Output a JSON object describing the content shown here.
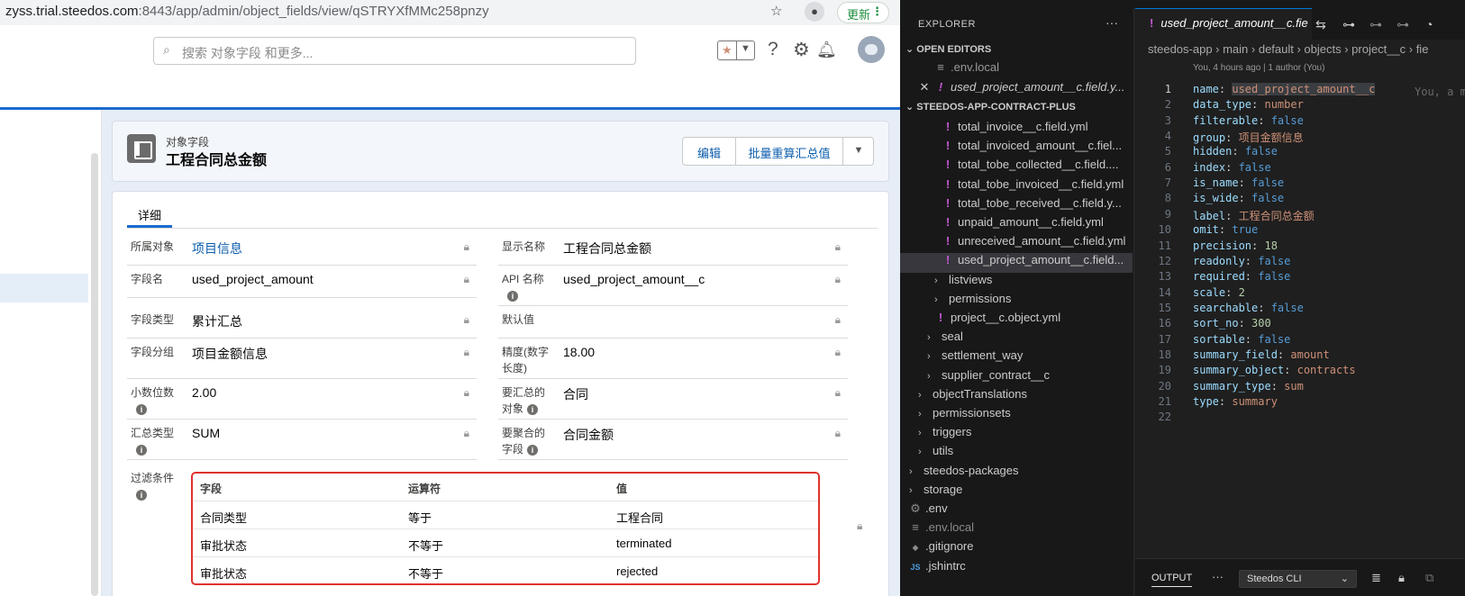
{
  "browser": {
    "url_host": "zyss.trial.steedos.com",
    "url_rest": ":8443/app/admin/object_fields/view/qSTRYXfMMc258pnzy",
    "update_label": "更新"
  },
  "app": {
    "search_placeholder": "搜索 对象字段 和更多..."
  },
  "record": {
    "object_label": "对象字段",
    "title": "工程合同总金额",
    "actions": [
      "编辑",
      "批量重算汇总值"
    ],
    "tab": "详细"
  },
  "fields_left": [
    {
      "label": "所属对象",
      "value": "项目信息",
      "link": true
    },
    {
      "label": "字段名",
      "value": "used_project_amount"
    },
    {
      "label": "字段类型",
      "value": "累计汇总"
    },
    {
      "label": "字段分组",
      "value": "项目金额信息"
    },
    {
      "label1": "小数位数",
      "value": "2.00"
    },
    {
      "label1": "汇总类型",
      "value": "SUM"
    }
  ],
  "fields_right": [
    {
      "label": "显示名称",
      "value": "工程合同总金额"
    },
    {
      "label1": "API 名称",
      "value": "used_project_amount__c"
    },
    {
      "label": "默认值",
      "value": ""
    },
    {
      "label1": "精度(数字",
      "label2": "长度)",
      "value": "18.00"
    },
    {
      "label1": "要汇总的",
      "label2": "对象",
      "value": "合同"
    },
    {
      "label1": "要聚合的",
      "label2": "字段",
      "value": "合同金额"
    }
  ],
  "filter": {
    "label": "过滤条件",
    "headers": [
      "字段",
      "运算符",
      "值"
    ],
    "rows": [
      [
        "合同类型",
        "等于",
        "工程合同"
      ],
      [
        "审批状态",
        "不等于",
        "terminated"
      ],
      [
        "审批状态",
        "不等于",
        "rejected"
      ]
    ]
  },
  "explorer": {
    "title": "EXPLORER",
    "open_editors": "OPEN EDITORS",
    "open_files": [
      ".env.local",
      "used_project_amount__c.field.y..."
    ],
    "project": "STEEDOS-APP-CONTRACT-PLUS",
    "tree": [
      {
        "name": "total_invoice__c.field.yml",
        "type": "yml",
        "depth": 3
      },
      {
        "name": "total_invoiced_amount__c.fiel...",
        "type": "yml",
        "depth": 3
      },
      {
        "name": "total_tobe_collected__c.field....",
        "type": "yml",
        "depth": 3
      },
      {
        "name": "total_tobe_invoiced__c.field.yml",
        "type": "yml",
        "depth": 3
      },
      {
        "name": "total_tobe_received__c.field.y...",
        "type": "yml",
        "depth": 3
      },
      {
        "name": "unpaid_amount__c.field.yml",
        "type": "yml",
        "depth": 3
      },
      {
        "name": "unreceived_amount__c.field.yml",
        "type": "yml",
        "depth": 3
      },
      {
        "name": "used_project_amount__c.field...",
        "type": "yml",
        "depth": 3,
        "selected": true
      },
      {
        "name": "listviews",
        "type": "folder",
        "depth": 2
      },
      {
        "name": "permissions",
        "type": "folder",
        "depth": 2
      },
      {
        "name": "project__c.object.yml",
        "type": "yml",
        "depth": 2
      },
      {
        "name": "seal",
        "type": "folder",
        "depth": 1
      },
      {
        "name": "settlement_way",
        "type": "folder",
        "depth": 1
      },
      {
        "name": "supplier_contract__c",
        "type": "folder",
        "depth": 1
      },
      {
        "name": "objectTranslations",
        "type": "folder",
        "depth": 0
      },
      {
        "name": "permissionsets",
        "type": "folder",
        "depth": 0
      },
      {
        "name": "triggers",
        "type": "folder",
        "depth": 0
      },
      {
        "name": "utils",
        "type": "folder",
        "depth": 0
      },
      {
        "name": "steedos-packages",
        "type": "folder",
        "depth": -1
      },
      {
        "name": "storage",
        "type": "folder",
        "depth": -1
      },
      {
        "name": ".env",
        "type": "gear",
        "depth": -1
      },
      {
        "name": ".env.local",
        "type": "lines",
        "depth": -1,
        "dim": true
      },
      {
        "name": ".gitignore",
        "type": "diamond",
        "depth": -1
      },
      {
        "name": ".jshintrc",
        "type": "js",
        "depth": -1
      }
    ]
  },
  "editor": {
    "tab": "used_project_amount__c.fie",
    "breadcrumb": "steedos-app  ›  main  ›  default  ›  objects  ›  project__c  ›  fie",
    "blame": "You, 4 hours ago | 1 author (You)",
    "ghost": "You, a m",
    "lines": [
      {
        "k": "name",
        "v": "used_project_amount__c",
        "t": "s"
      },
      {
        "k": "data_type",
        "v": "number",
        "t": "s"
      },
      {
        "k": "filterable",
        "v": "false",
        "t": "b"
      },
      {
        "k": "group",
        "v": "项目金额信息",
        "t": "s"
      },
      {
        "k": "hidden",
        "v": "false",
        "t": "b"
      },
      {
        "k": "index",
        "v": "false",
        "t": "b"
      },
      {
        "k": "is_name",
        "v": "false",
        "t": "b"
      },
      {
        "k": "is_wide",
        "v": "false",
        "t": "b"
      },
      {
        "k": "label",
        "v": "工程合同总金额",
        "t": "s"
      },
      {
        "k": "omit",
        "v": "true",
        "t": "b"
      },
      {
        "k": "precision",
        "v": "18",
        "t": "n"
      },
      {
        "k": "readonly",
        "v": "false",
        "t": "b"
      },
      {
        "k": "required",
        "v": "false",
        "t": "b"
      },
      {
        "k": "scale",
        "v": "2",
        "t": "n"
      },
      {
        "k": "searchable",
        "v": "false",
        "t": "b"
      },
      {
        "k": "sort_no",
        "v": "300",
        "t": "n"
      },
      {
        "k": "sortable",
        "v": "false",
        "t": "b"
      },
      {
        "k": "summary_field",
        "v": "amount",
        "t": "s"
      },
      {
        "k": "summary_object",
        "v": "contracts",
        "t": "s"
      },
      {
        "k": "summary_type",
        "v": "sum",
        "t": "s"
      },
      {
        "k": "type",
        "v": "summary",
        "t": "s"
      },
      {
        "k": "",
        "v": "",
        "t": "s"
      }
    ]
  },
  "panel": {
    "tab": "OUTPUT",
    "channel": "Steedos CLI"
  }
}
